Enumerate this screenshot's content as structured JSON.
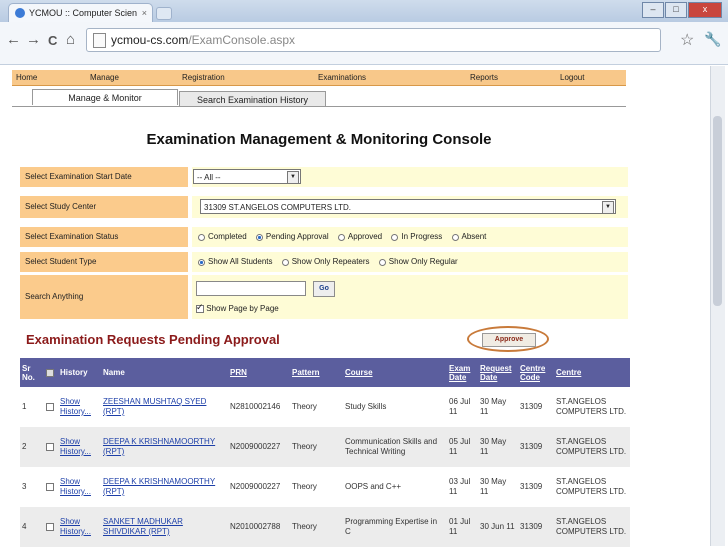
{
  "browser": {
    "tab_title": "YCMOU :: Computer Scien",
    "tab_close": "×",
    "url_host": "ycmou-cs.com",
    "url_path": "/ExamConsole.aspx",
    "back": "←",
    "forward": "→",
    "reload": "C",
    "home": "⌂",
    "star": "☆",
    "wrench": "🔧",
    "win_min": "–",
    "win_max": "□",
    "win_close": "x"
  },
  "menu": [
    "Home",
    "Manage",
    "Registration",
    "Examinations",
    "Reports",
    "Logout"
  ],
  "subtabs": {
    "active": "Manage & Monitor",
    "inactive": "Search Examination History"
  },
  "page_title": "Examination Management & Monitoring Console",
  "form": {
    "start_date": {
      "label": "Select Examination Start Date",
      "value": "-- All --"
    },
    "study_center": {
      "label": "Select Study Center",
      "value": "31309 ST.ANGELOS COMPUTERS LTD."
    },
    "status": {
      "label": "Select Examination Status",
      "options": [
        "Completed",
        "Pending Approval",
        "Approved",
        "In Progress",
        "Absent"
      ],
      "selected": 1
    },
    "student_type": {
      "label": "Select Student Type",
      "options": [
        "Show All Students",
        "Show Only Repeaters",
        "Show Only Regular"
      ],
      "selected": 0
    },
    "search": {
      "label": "Search Anything",
      "go": "Go",
      "page_by_page": "Show Page by Page"
    }
  },
  "section_title": "Examination Requests Pending Approval",
  "approve_label": "Approve",
  "table": {
    "headers": {
      "sr": "Sr No.",
      "history": "History",
      "name": "Name",
      "prn": "PRN",
      "pattern": "Pattern",
      "course": "Course",
      "exam_date": "Exam Date",
      "request_date": "Request Date",
      "centre_code": "Centre Code",
      "centre": "Centre"
    },
    "rows": [
      {
        "sr": "1",
        "history": "Show History...",
        "name": "ZEESHAN MUSHTAQ SYED (RPT)",
        "prn": "N2810002146",
        "pattern": "Theory",
        "course": "Study Skills",
        "exam_date": "06 Jul 11",
        "request_date": "30 May 11",
        "centre_code": "31309",
        "centre": "ST.ANGELOS COMPUTERS LTD."
      },
      {
        "sr": "2",
        "history": "Show History...",
        "name": "DEEPA K KRISHNAMOORTHY (RPT)",
        "prn": "N2009000227",
        "pattern": "Theory",
        "course": "Communication Skills and Technical Writing",
        "exam_date": "05 Jul 11",
        "request_date": "30 May 11",
        "centre_code": "31309",
        "centre": "ST.ANGELOS COMPUTERS LTD."
      },
      {
        "sr": "3",
        "history": "Show History...",
        "name": "DEEPA K KRISHNAMOORTHY (RPT)",
        "prn": "N2009000227",
        "pattern": "Theory",
        "course": "OOPS and C++",
        "exam_date": "03 Jul 11",
        "request_date": "30 May 11",
        "centre_code": "31309",
        "centre": "ST.ANGELOS COMPUTERS LTD."
      },
      {
        "sr": "4",
        "history": "Show History...",
        "name": "SANKET MADHUKAR SHIVDIKAR (RPT)",
        "prn": "N2010002788",
        "pattern": "Theory",
        "course": "Programming Expertise in C",
        "exam_date": "01 Jul 11",
        "request_date": "30 Jun 11",
        "centre_code": "31309",
        "centre": "ST.ANGELOS COMPUTERS LTD."
      }
    ]
  }
}
